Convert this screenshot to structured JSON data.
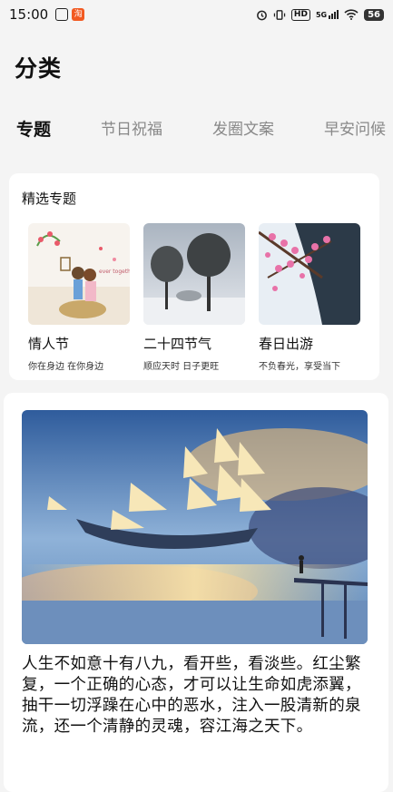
{
  "status": {
    "time": "15:00",
    "app_icons": [
      "bike-share-icon",
      "taobao-app-icon"
    ],
    "right_icons": [
      "alarm-icon",
      "vibrate-icon",
      "hd-icon",
      "signal-5g-icon",
      "wifi-icon"
    ],
    "hd": "HD",
    "net": "5G",
    "battery": "56"
  },
  "page": {
    "title": "分类"
  },
  "tabs": [
    {
      "label": "专题",
      "active": true
    },
    {
      "label": "节日祝福",
      "active": false
    },
    {
      "label": "发圈文案",
      "active": false
    },
    {
      "label": "早安问候",
      "active": false
    }
  ],
  "featured": {
    "heading": "精选专题",
    "topics": [
      {
        "name": "情人节",
        "subtitle": "你在身边  在你身边"
      },
      {
        "name": "二十四节气",
        "subtitle": "顺应天时  日子更旺"
      },
      {
        "name": "春日出游",
        "subtitle": "不负春光，享受当下"
      }
    ]
  },
  "quote": {
    "text": "人生不如意十有八九，看开些，看淡些。红尘繁复，一个正确的心态，才可以让生命如虎添翼，抽干一切浮躁在心中的恶水，注入一股清新的泉流，还一个清静的灵魂，容江海之天下。"
  }
}
